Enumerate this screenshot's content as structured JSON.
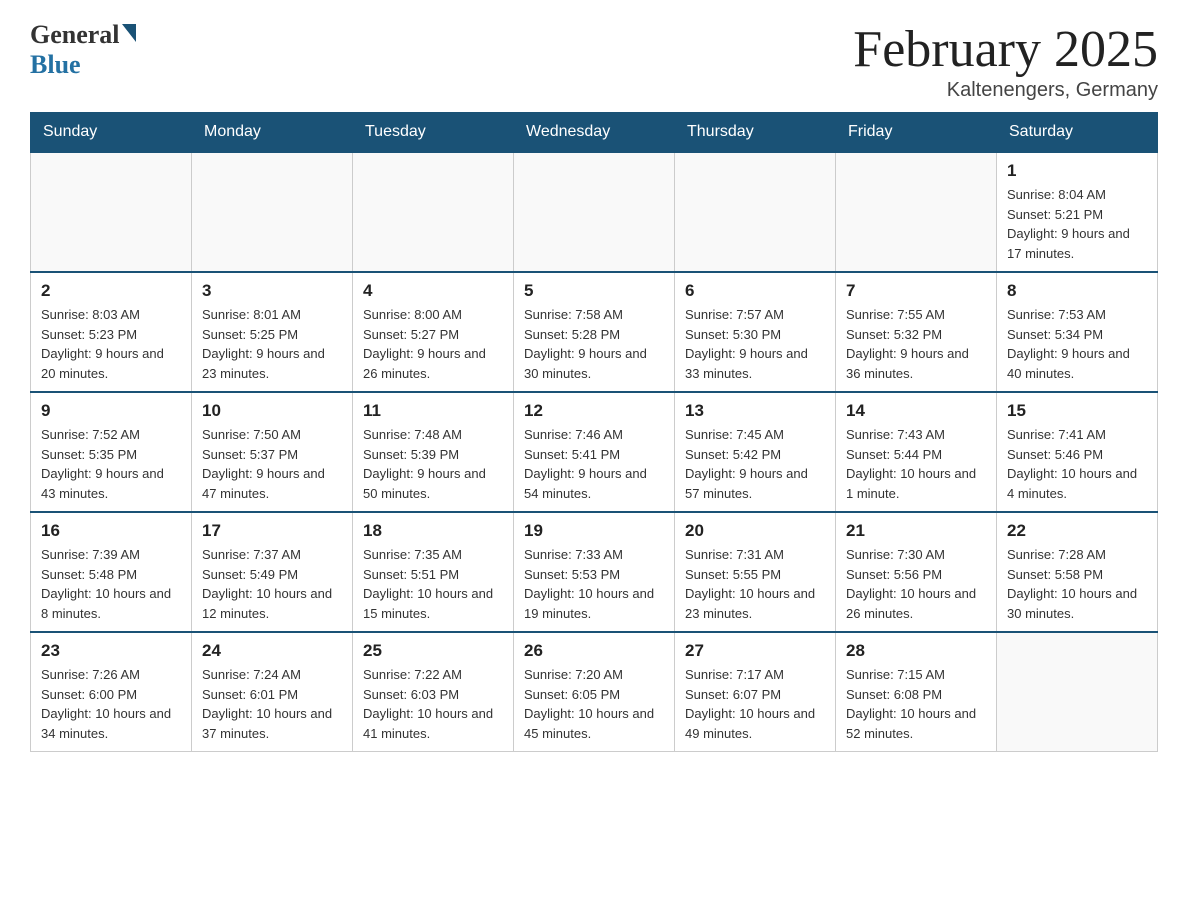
{
  "header": {
    "logo": {
      "general": "General",
      "blue": "Blue"
    },
    "title": "February 2025",
    "location": "Kaltenengers, Germany"
  },
  "weekdays": [
    "Sunday",
    "Monday",
    "Tuesday",
    "Wednesday",
    "Thursday",
    "Friday",
    "Saturday"
  ],
  "weeks": [
    [
      {
        "day": "",
        "info": ""
      },
      {
        "day": "",
        "info": ""
      },
      {
        "day": "",
        "info": ""
      },
      {
        "day": "",
        "info": ""
      },
      {
        "day": "",
        "info": ""
      },
      {
        "day": "",
        "info": ""
      },
      {
        "day": "1",
        "info": "Sunrise: 8:04 AM\nSunset: 5:21 PM\nDaylight: 9 hours and 17 minutes."
      }
    ],
    [
      {
        "day": "2",
        "info": "Sunrise: 8:03 AM\nSunset: 5:23 PM\nDaylight: 9 hours and 20 minutes."
      },
      {
        "day": "3",
        "info": "Sunrise: 8:01 AM\nSunset: 5:25 PM\nDaylight: 9 hours and 23 minutes."
      },
      {
        "day": "4",
        "info": "Sunrise: 8:00 AM\nSunset: 5:27 PM\nDaylight: 9 hours and 26 minutes."
      },
      {
        "day": "5",
        "info": "Sunrise: 7:58 AM\nSunset: 5:28 PM\nDaylight: 9 hours and 30 minutes."
      },
      {
        "day": "6",
        "info": "Sunrise: 7:57 AM\nSunset: 5:30 PM\nDaylight: 9 hours and 33 minutes."
      },
      {
        "day": "7",
        "info": "Sunrise: 7:55 AM\nSunset: 5:32 PM\nDaylight: 9 hours and 36 minutes."
      },
      {
        "day": "8",
        "info": "Sunrise: 7:53 AM\nSunset: 5:34 PM\nDaylight: 9 hours and 40 minutes."
      }
    ],
    [
      {
        "day": "9",
        "info": "Sunrise: 7:52 AM\nSunset: 5:35 PM\nDaylight: 9 hours and 43 minutes."
      },
      {
        "day": "10",
        "info": "Sunrise: 7:50 AM\nSunset: 5:37 PM\nDaylight: 9 hours and 47 minutes."
      },
      {
        "day": "11",
        "info": "Sunrise: 7:48 AM\nSunset: 5:39 PM\nDaylight: 9 hours and 50 minutes."
      },
      {
        "day": "12",
        "info": "Sunrise: 7:46 AM\nSunset: 5:41 PM\nDaylight: 9 hours and 54 minutes."
      },
      {
        "day": "13",
        "info": "Sunrise: 7:45 AM\nSunset: 5:42 PM\nDaylight: 9 hours and 57 minutes."
      },
      {
        "day": "14",
        "info": "Sunrise: 7:43 AM\nSunset: 5:44 PM\nDaylight: 10 hours and 1 minute."
      },
      {
        "day": "15",
        "info": "Sunrise: 7:41 AM\nSunset: 5:46 PM\nDaylight: 10 hours and 4 minutes."
      }
    ],
    [
      {
        "day": "16",
        "info": "Sunrise: 7:39 AM\nSunset: 5:48 PM\nDaylight: 10 hours and 8 minutes."
      },
      {
        "day": "17",
        "info": "Sunrise: 7:37 AM\nSunset: 5:49 PM\nDaylight: 10 hours and 12 minutes."
      },
      {
        "day": "18",
        "info": "Sunrise: 7:35 AM\nSunset: 5:51 PM\nDaylight: 10 hours and 15 minutes."
      },
      {
        "day": "19",
        "info": "Sunrise: 7:33 AM\nSunset: 5:53 PM\nDaylight: 10 hours and 19 minutes."
      },
      {
        "day": "20",
        "info": "Sunrise: 7:31 AM\nSunset: 5:55 PM\nDaylight: 10 hours and 23 minutes."
      },
      {
        "day": "21",
        "info": "Sunrise: 7:30 AM\nSunset: 5:56 PM\nDaylight: 10 hours and 26 minutes."
      },
      {
        "day": "22",
        "info": "Sunrise: 7:28 AM\nSunset: 5:58 PM\nDaylight: 10 hours and 30 minutes."
      }
    ],
    [
      {
        "day": "23",
        "info": "Sunrise: 7:26 AM\nSunset: 6:00 PM\nDaylight: 10 hours and 34 minutes."
      },
      {
        "day": "24",
        "info": "Sunrise: 7:24 AM\nSunset: 6:01 PM\nDaylight: 10 hours and 37 minutes."
      },
      {
        "day": "25",
        "info": "Sunrise: 7:22 AM\nSunset: 6:03 PM\nDaylight: 10 hours and 41 minutes."
      },
      {
        "day": "26",
        "info": "Sunrise: 7:20 AM\nSunset: 6:05 PM\nDaylight: 10 hours and 45 minutes."
      },
      {
        "day": "27",
        "info": "Sunrise: 7:17 AM\nSunset: 6:07 PM\nDaylight: 10 hours and 49 minutes."
      },
      {
        "day": "28",
        "info": "Sunrise: 7:15 AM\nSunset: 6:08 PM\nDaylight: 10 hours and 52 minutes."
      },
      {
        "day": "",
        "info": ""
      }
    ]
  ]
}
